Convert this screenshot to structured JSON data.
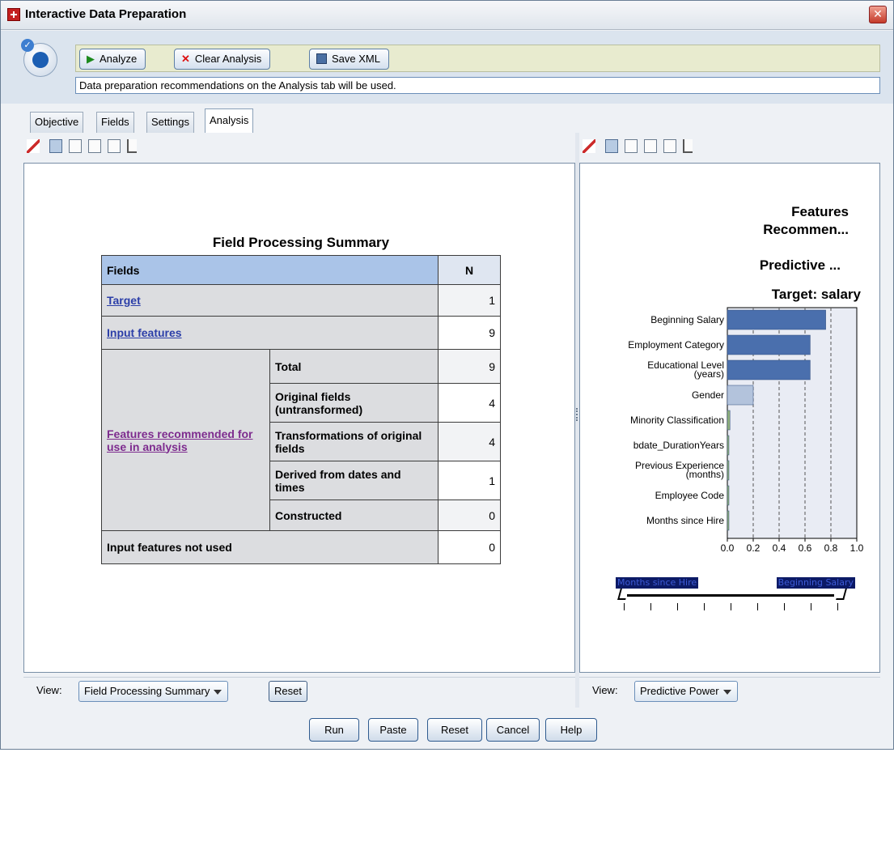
{
  "window": {
    "title": "Interactive Data Preparation",
    "close": "✕"
  },
  "toolbar": {
    "analyze": "Analyze",
    "clear_analysis": "Clear Analysis",
    "save_xml": "Save XML"
  },
  "status_text": "Data preparation recommendations on the Analysis tab will be used.",
  "tabs": [
    {
      "label": "Objective"
    },
    {
      "label": "Fields"
    },
    {
      "label": "Settings"
    },
    {
      "label": "Analysis",
      "active": true
    }
  ],
  "left_view": {
    "title": "Field Processing Summary",
    "header": {
      "fields": "Fields",
      "n": "N"
    },
    "rows": {
      "target": {
        "label": "Target",
        "n": "1"
      },
      "input_features": {
        "label": "Input features",
        "n": "9"
      },
      "features_recommended": {
        "label": "Features recommended for use in analysis",
        "sub": [
          {
            "label": "Total",
            "n": "9"
          },
          {
            "label": "Original fields (untransformed)",
            "n": "4"
          },
          {
            "label": "Transformations of original fields",
            "n": "4"
          },
          {
            "label": "Derived from dates and times",
            "n": "1"
          },
          {
            "label": "Constructed",
            "n": "0"
          }
        ]
      },
      "not_used": {
        "label": "Input features not used",
        "n": "0"
      }
    },
    "view_label": "View:",
    "view_value": "Field Processing Summary",
    "reset": "Reset"
  },
  "right_view": {
    "title_line1": "Features",
    "title_line2": "Recommen...",
    "subtitle": "Predictive ...",
    "target_label": "Target: salary",
    "view_label": "View:",
    "view_value": "Predictive Power",
    "slider_left": "Months since Hire",
    "slider_right": "Beginning Salary"
  },
  "chart_data": {
    "type": "bar",
    "orientation": "horizontal",
    "categories": [
      "Beginning Salary",
      "Employment Category",
      "Educational Level (years)",
      "Gender",
      "Minority Classification",
      "bdate_DurationYears",
      "Previous Experience (months)",
      "Employee Code",
      "Months since Hire"
    ],
    "values": [
      0.76,
      0.64,
      0.64,
      0.2,
      0.02,
      0.01,
      0.01,
      0.01,
      0.01
    ],
    "xlim": [
      0.0,
      1.0
    ],
    "ticks": [
      "0.0",
      "0.2",
      "0.4",
      "0.6",
      "0.8",
      "1.0"
    ],
    "grid": true,
    "colors": {
      "bar": "#4a6fad",
      "bar_light": "#b3c3dc",
      "bg": "#e9ecf4"
    }
  },
  "footer": {
    "run": "Run",
    "paste": "Paste",
    "reset": "Reset",
    "cancel": "Cancel",
    "help": "Help"
  }
}
